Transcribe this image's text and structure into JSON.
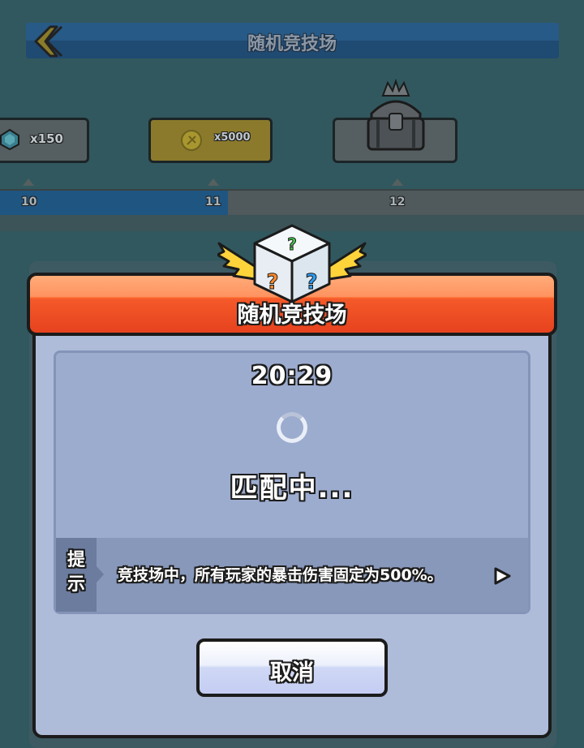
{
  "background": {
    "title": "随机竞技场",
    "rewards": [
      {
        "label": "x150",
        "icon": "gem-icon"
      },
      {
        "label": "x5000",
        "icon": "coin-icon"
      },
      {
        "label": "",
        "icon": "crowned-chest-icon"
      }
    ],
    "track_labels": [
      "10",
      "11",
      "12"
    ],
    "track_progress": 0.39
  },
  "modal": {
    "title": "随机竞技场",
    "timer": "20:29",
    "status": "匹配中...",
    "tip_label_line1": "提",
    "tip_label_line2": "示",
    "tip_text": "竞技场中，所有玩家的暴击伤害固定为500%。",
    "cancel_label": "取消"
  },
  "colors": {
    "header": "#f55a2a",
    "panel": "#aebbd9",
    "button": "#cfd8f5"
  }
}
